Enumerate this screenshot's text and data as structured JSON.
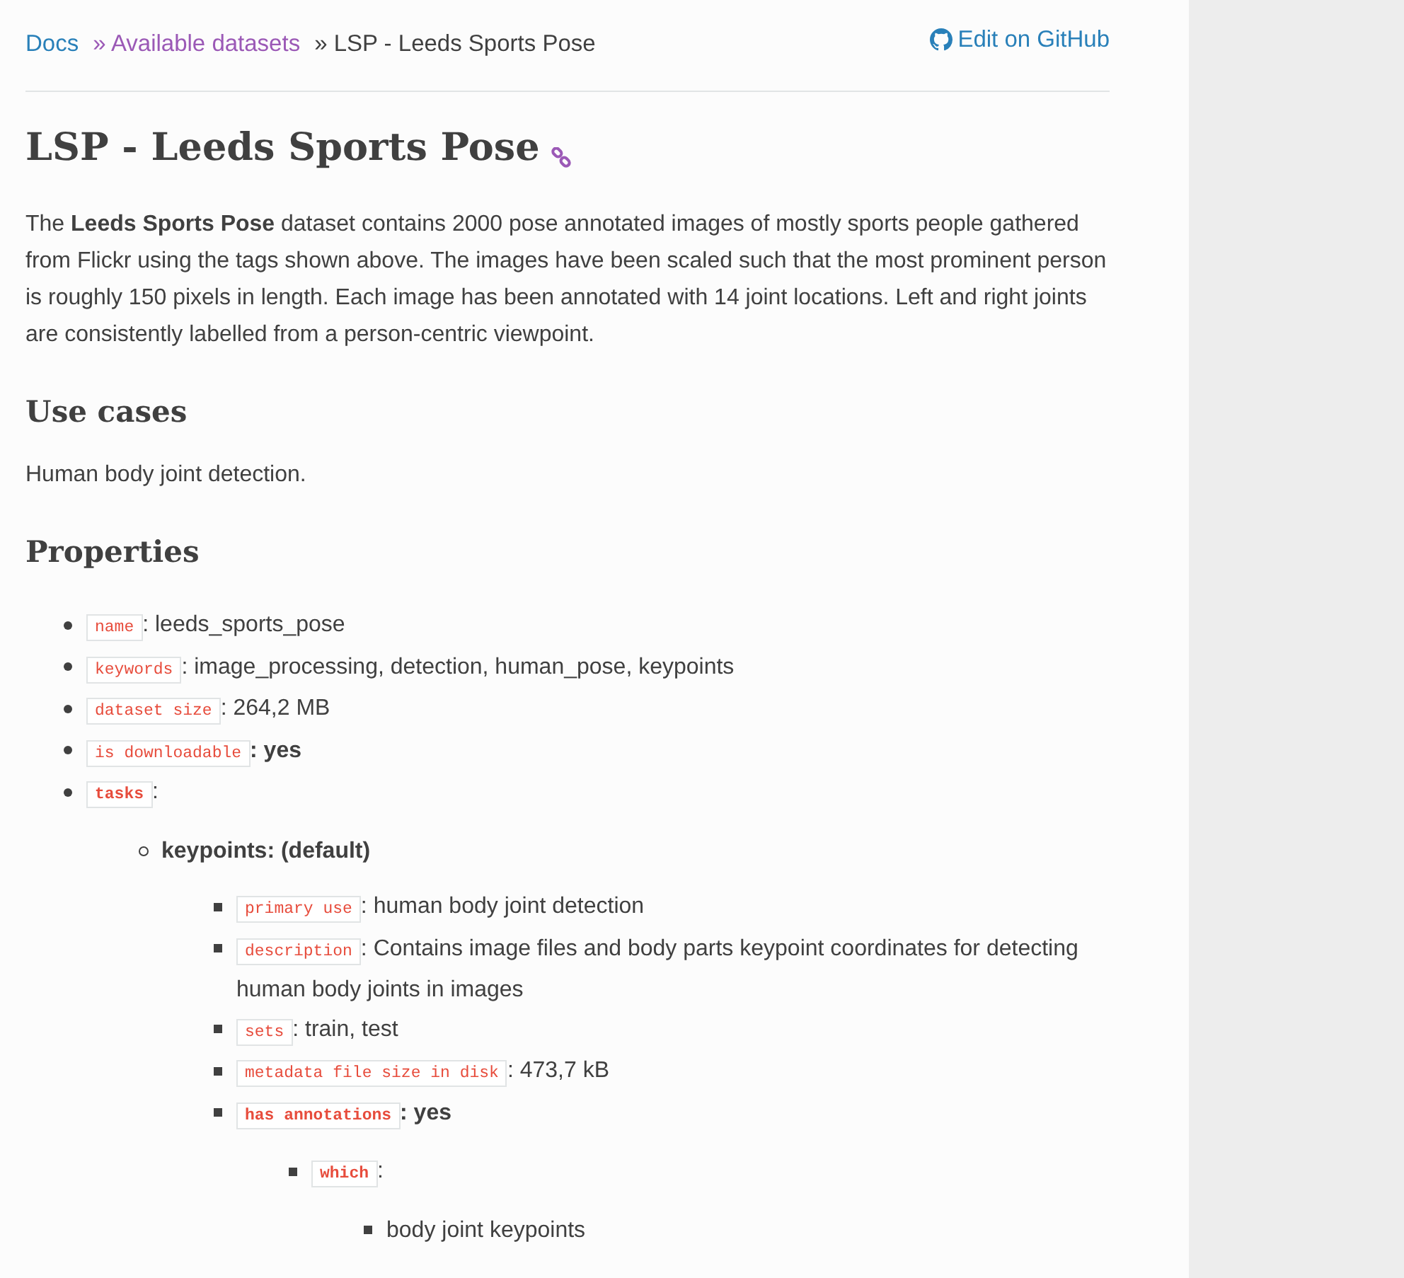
{
  "breadcrumbs": [
    {
      "label": "Docs",
      "kind": "link",
      "visited": false
    },
    {
      "label": "» Available datasets",
      "kind": "link",
      "visited": true
    },
    {
      "label": "» LSP - Leeds Sports Pose",
      "kind": "current"
    }
  ],
  "edit_link": "Edit on GitHub",
  "title": "LSP - Leeds Sports Pose",
  "intro": "The **Leeds Sports Pose** dataset contains 2000 pose annotated images of mostly sports people gathered from Flickr using the tags shown above. The images have been scaled such that the most prominent person is roughly 150 pixels in length. Each image has been annotated with 14 joint locations. Left and right joints are consistently labelled from a person-centric viewpoint.",
  "sections": [
    {
      "heading": "Use cases",
      "text": "Human body joint detection."
    },
    {
      "heading": "Properties"
    }
  ],
  "properties": [
    {
      "key": "name",
      "key_bold": false,
      "value": ": leeds_sports_pose",
      "value_bold": false
    },
    {
      "key": "keywords",
      "key_bold": false,
      "value": ": image_processing, detection, human_pose, keypoints",
      "value_bold": false
    },
    {
      "key": "dataset size",
      "key_bold": false,
      "value": ": 264,2 MB",
      "value_bold": false
    },
    {
      "key": "is downloadable",
      "key_bold": false,
      "value": ": yes",
      "value_bold": true
    },
    {
      "key": "tasks",
      "key_bold": true,
      "value": ":",
      "value_bold": false,
      "children": [
        {
          "value": "keypoints: (default)",
          "value_bold": true,
          "children": [
            {
              "key": "primary use",
              "key_bold": false,
              "value": ": human body joint detection",
              "value_bold": false
            },
            {
              "key": "description",
              "key_bold": false,
              "value": ": Contains image files and body parts keypoint coordinates for detecting human body joints in images",
              "value_bold": false
            },
            {
              "key": "sets",
              "key_bold": false,
              "value": ": train, test",
              "value_bold": false
            },
            {
              "key": "metadata file size in disk",
              "key_bold": false,
              "value": ": 473,7 kB",
              "value_bold": false
            },
            {
              "key": "has annotations",
              "key_bold": true,
              "value": ": yes",
              "value_bold": true,
              "children": [
                {
                  "key": "which",
                  "key_bold": true,
                  "value": ":",
                  "value_bold": false,
                  "children": [
                    {
                      "value": "body joint keypoints",
                      "value_bold": false
                    }
                  ]
                }
              ]
            }
          ]
        }
      ]
    }
  ]
}
